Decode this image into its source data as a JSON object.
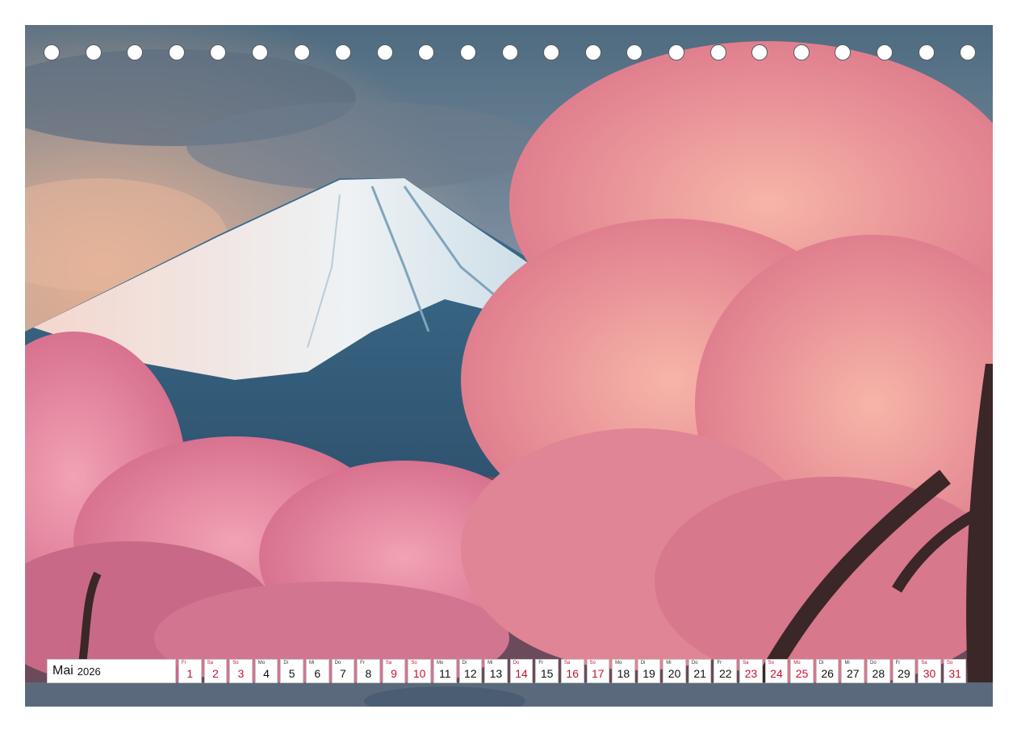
{
  "calendar": {
    "month": "Mai",
    "year": "2026",
    "days": [
      {
        "wd": "Fr",
        "num": "1",
        "red": true
      },
      {
        "wd": "Sa",
        "num": "2",
        "red": true
      },
      {
        "wd": "So",
        "num": "3",
        "red": true
      },
      {
        "wd": "Mo",
        "num": "4",
        "red": false
      },
      {
        "wd": "Di",
        "num": "5",
        "red": false
      },
      {
        "wd": "Mi",
        "num": "6",
        "red": false
      },
      {
        "wd": "Do",
        "num": "7",
        "red": false
      },
      {
        "wd": "Fr",
        "num": "8",
        "red": false
      },
      {
        "wd": "Sa",
        "num": "9",
        "red": true
      },
      {
        "wd": "So",
        "num": "10",
        "red": true
      },
      {
        "wd": "Mo",
        "num": "11",
        "red": false
      },
      {
        "wd": "Di",
        "num": "12",
        "red": false
      },
      {
        "wd": "Mi",
        "num": "13",
        "red": false
      },
      {
        "wd": "Do",
        "num": "14",
        "red": true
      },
      {
        "wd": "Fr",
        "num": "15",
        "red": false
      },
      {
        "wd": "Sa",
        "num": "16",
        "red": true
      },
      {
        "wd": "So",
        "num": "17",
        "red": true
      },
      {
        "wd": "Mo",
        "num": "18",
        "red": false
      },
      {
        "wd": "Di",
        "num": "19",
        "red": false
      },
      {
        "wd": "Mi",
        "num": "20",
        "red": false
      },
      {
        "wd": "Do",
        "num": "21",
        "red": false
      },
      {
        "wd": "Fr",
        "num": "22",
        "red": false
      },
      {
        "wd": "Sa",
        "num": "23",
        "red": true
      },
      {
        "wd": "So",
        "num": "24",
        "red": true
      },
      {
        "wd": "Mo",
        "num": "25",
        "red": true
      },
      {
        "wd": "Di",
        "num": "26",
        "red": false
      },
      {
        "wd": "Mi",
        "num": "27",
        "red": false
      },
      {
        "wd": "Do",
        "num": "28",
        "red": false
      },
      {
        "wd": "Fr",
        "num": "29",
        "red": false
      },
      {
        "wd": "Sa",
        "num": "30",
        "red": true
      },
      {
        "wd": "So",
        "num": "31",
        "red": true
      }
    ]
  },
  "colors": {
    "holiday": "#c8102e",
    "blossom": "#e48aa0",
    "sky": "#5d7a8f"
  }
}
